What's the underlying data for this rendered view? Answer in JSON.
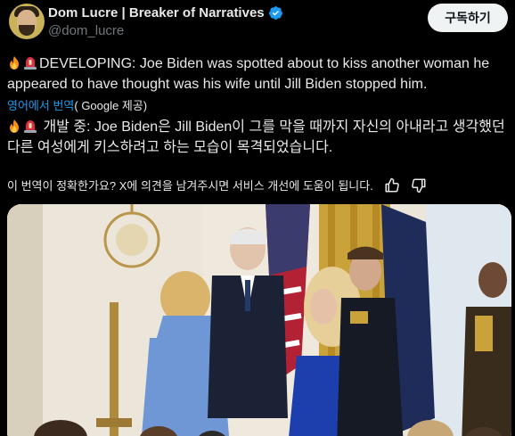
{
  "author": {
    "display_name": "Dom Lucre | Breaker of Narratives",
    "handle": "@dom_lucre",
    "verified": true
  },
  "actions": {
    "subscribe_label": "구독하기"
  },
  "post": {
    "text_en": "DEVELOPING: Joe Biden was spotted about to kiss another woman he appeared to have thought was his wife until Jill Biden stopped him.",
    "text_ko": "개발 중: Joe Biden은 Jill Biden이 그를 막을 때까지 자신의 아내라고 생각했던 다른 여성에게 키스하려고 하는 모습이 목격되었습니다.",
    "translate_link": "영어에서 번역",
    "translate_suffix": "( Google 제공)"
  },
  "feedback": {
    "question": "이 번역이 정확한가요? X에 의견을 남겨주시면 서비스 개선에 도움이 됩니다."
  },
  "icons": {
    "verified": "verified-badge-icon",
    "fire": "fire-emoji-icon",
    "siren": "siren-emoji-icon",
    "thumbs_up": "thumbs-up-icon",
    "thumbs_down": "thumbs-down-icon"
  },
  "colors": {
    "background": "#000000",
    "text": "#e7e9ea",
    "muted": "#71767b",
    "link": "#1d9bf0",
    "button_bg": "#eff3f4"
  }
}
